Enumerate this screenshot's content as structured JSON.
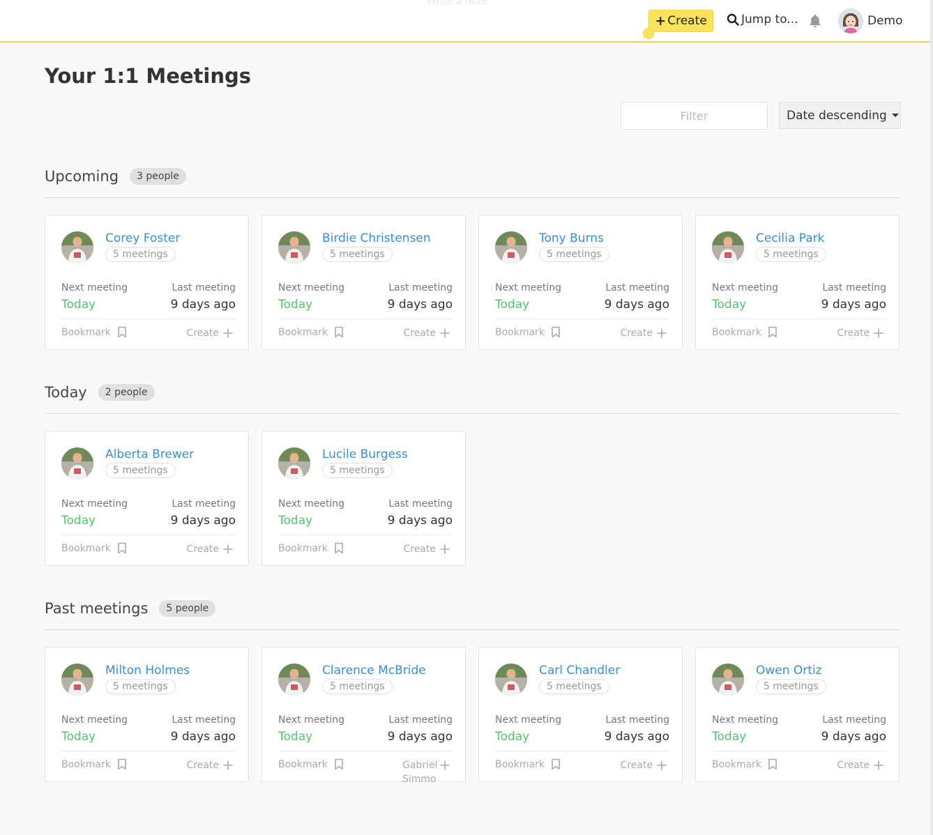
{
  "topbar": {
    "faint_note": "Write a Note",
    "create_label": "Create",
    "jump_label": "Jump to...",
    "user_name": "Demo"
  },
  "page": {
    "title": "Your 1:1 Meetings",
    "filter_placeholder": "Filter",
    "sort_label": "Date descending"
  },
  "labels": {
    "next_meeting": "Next meeting",
    "last_meeting": "Last meeting",
    "bookmark": "Bookmark",
    "create": "Create"
  },
  "sections": [
    {
      "title": "Upcoming",
      "count": "3 people",
      "cards": [
        {
          "name": "Corey Foster",
          "meetings": "5 meetings",
          "next": "Today",
          "last": "9 days ago",
          "action": "Create"
        },
        {
          "name": "Birdie Christensen",
          "meetings": "5 meetings",
          "next": "Today",
          "last": "9 days ago",
          "action": "Create"
        },
        {
          "name": "Tony Burns",
          "meetings": "5 meetings",
          "next": "Today",
          "last": "9 days ago",
          "action": "Create"
        },
        {
          "name": "Cecilia Park",
          "meetings": "5 meetings",
          "next": "Today",
          "last": "9 days ago",
          "action": "Create"
        }
      ]
    },
    {
      "title": "Today",
      "count": "2 people",
      "cards": [
        {
          "name": "Alberta Brewer",
          "meetings": "5 meetings",
          "next": "Today",
          "last": "9 days ago",
          "action": "Create"
        },
        {
          "name": "Lucile Burgess",
          "meetings": "5 meetings",
          "next": "Today",
          "last": "9 days ago",
          "action": "Create"
        }
      ]
    },
    {
      "title": "Past meetings",
      "count": "5 people",
      "cards": [
        {
          "name": "Milton Holmes",
          "meetings": "5 meetings",
          "next": "Today",
          "last": "9 days ago",
          "action": "Create"
        },
        {
          "name": "Clarence McBride",
          "meetings": "5 meetings",
          "next": "Today",
          "last": "9 days ago",
          "action": "Gabriel Simmo"
        },
        {
          "name": "Carl Chandler",
          "meetings": "5 meetings",
          "next": "Today",
          "last": "9 days ago",
          "action": "Create"
        },
        {
          "name": "Owen Ortiz",
          "meetings": "5 meetings",
          "next": "Today",
          "last": "9 days ago",
          "action": "Create"
        }
      ]
    }
  ],
  "colors": {
    "accent_yellow": "#fce35a",
    "link_blue": "#3b8fd1",
    "today_green": "#4dc96e"
  },
  "icons": [
    "search-icon",
    "bell-icon",
    "bookmark-icon",
    "plus-icon",
    "user-avatar"
  ]
}
